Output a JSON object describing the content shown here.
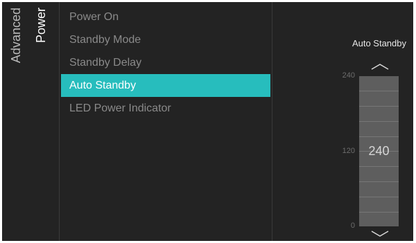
{
  "breadcrumb": {
    "parent": "Advanced",
    "current": "Power"
  },
  "menu": {
    "items": [
      {
        "label": "Power On",
        "selected": false
      },
      {
        "label": "Standby Mode",
        "selected": false
      },
      {
        "label": "Standby Delay",
        "selected": false
      },
      {
        "label": "Auto Standby",
        "selected": true
      },
      {
        "label": "LED Power Indicator",
        "selected": false
      }
    ]
  },
  "auto_standby": {
    "title": "Auto Standby",
    "max_label": "240",
    "mid_label": "120",
    "min_label": "0",
    "value": "240",
    "up_icon": "chevron-up-icon",
    "down_icon": "chevron-down-icon"
  },
  "colors": {
    "background": "#232323",
    "accent": "#27bdbd",
    "slider": "#5e5e5e"
  }
}
